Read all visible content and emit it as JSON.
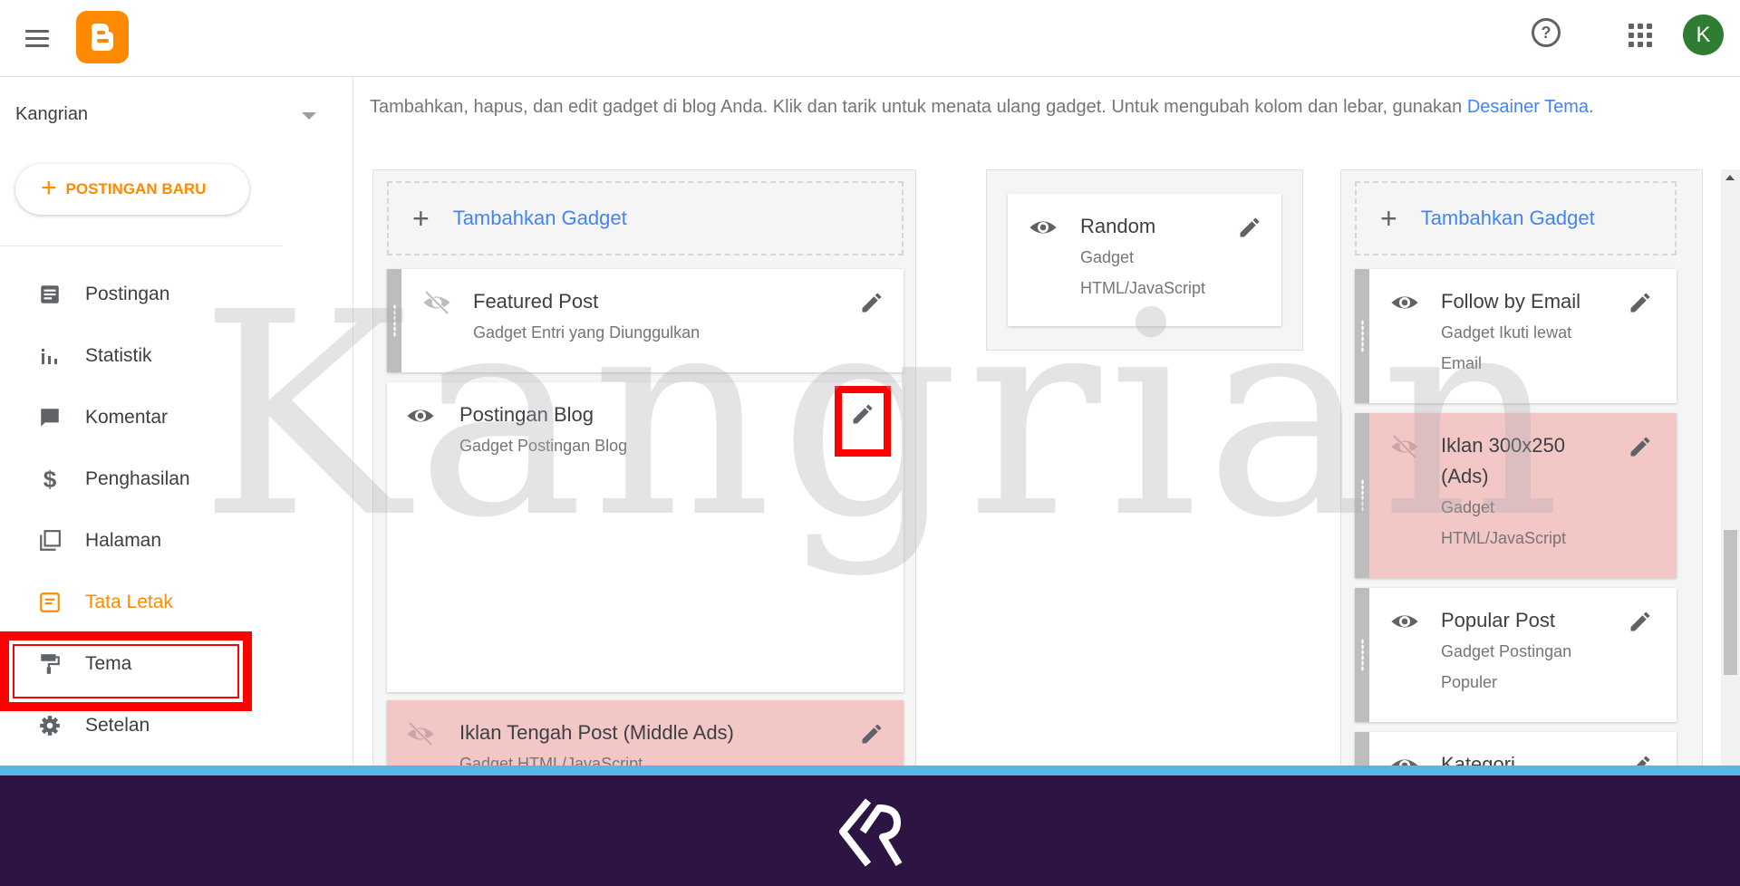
{
  "header": {
    "icons": [
      "menu-icon",
      "blogger-logo",
      "help-icon",
      "apps-icon"
    ],
    "avatar_initial": "K"
  },
  "sidebar": {
    "blog_name": "Kangrian",
    "new_post_label": "POSTINGAN BARU",
    "items": [
      {
        "label": "Postingan",
        "icon": "posts-icon"
      },
      {
        "label": "Statistik",
        "icon": "stats-icon"
      },
      {
        "label": "Komentar",
        "icon": "comment-icon"
      },
      {
        "label": "Penghasilan",
        "icon": "dollar-icon"
      },
      {
        "label": "Halaman",
        "icon": "pages-icon"
      },
      {
        "label": "Tata Letak",
        "icon": "layout-icon",
        "active": true
      },
      {
        "label": "Tema",
        "icon": "paint-roller-icon"
      },
      {
        "label": "Setelan",
        "icon": "gear-icon"
      }
    ]
  },
  "main": {
    "info_text": "Tambahkan, hapus, dan edit gadget di blog Anda. Klik dan tarik untuk menata ulang gadget. Untuk mengubah kolom dan lebar, gunakan",
    "info_link": "Desainer Tema",
    "info_period": ".",
    "add_gadget_label": "Tambahkan Gadget",
    "left_column": [
      {
        "title": "Featured Post",
        "subtitle": "Gadget Entri yang Diunggulkan",
        "visible": false
      },
      {
        "title": "Postingan Blog",
        "subtitle": "Gadget Postingan Blog",
        "visible": true
      },
      {
        "title": "Iklan Tengah Post (Middle Ads)",
        "subtitle": "Gadget HTML/JavaScript",
        "visible": false
      }
    ],
    "middle_column": [
      {
        "title": "Random",
        "subtitle_line1": "Gadget",
        "subtitle_line2": "HTML/JavaScript",
        "visible": true
      }
    ],
    "right_column": [
      {
        "title": "Follow by Email",
        "subtitle_line1": "Gadget Ikuti lewat",
        "subtitle_line2": "Email",
        "visible": true
      },
      {
        "title_line1": "Iklan 300x250",
        "title_line2": "(Ads)",
        "subtitle_line1": "Gadget",
        "subtitle_line2": "HTML/JavaScript",
        "visible": false
      },
      {
        "title": "Popular Post",
        "subtitle_line1": "Gadget Postingan",
        "subtitle_line2": "Populer",
        "visible": true
      },
      {
        "title": "Kategori",
        "visible": true
      }
    ]
  },
  "watermark_text": "Kangrian",
  "colors": {
    "accent": "#ff8a00",
    "link": "#4285f4",
    "highlight": "#ff0000",
    "hidden_gadget_bg": "#f4c7c7",
    "footer_bg": "#2c1543",
    "footer_line": "#5ab4e8"
  }
}
